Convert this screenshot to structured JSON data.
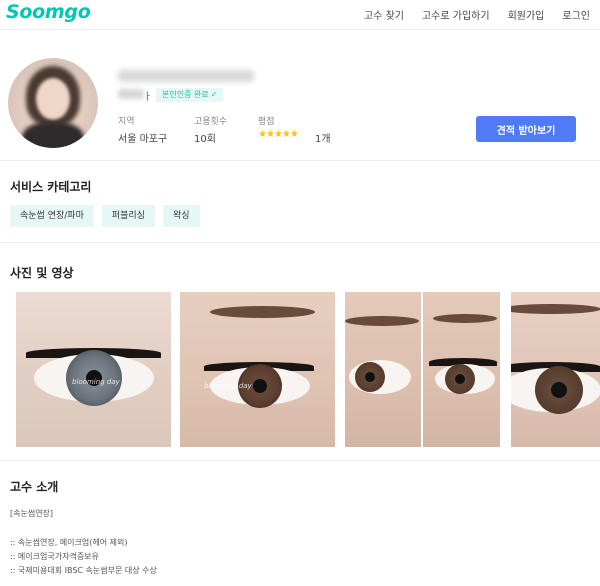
{
  "header": {
    "logo": "Soomgo",
    "nav": [
      "고수 찾기",
      "고수로 가입하기",
      "회원가입",
      "로그인"
    ]
  },
  "profile": {
    "sub_char": "ㅏ",
    "verified_badge": "본인인증 완료",
    "verified_icon": "check-icon",
    "stats": {
      "region_label": "지역",
      "region_value": "서울 마포구",
      "hires_label": "고용횟수",
      "hires_value": "10회",
      "rating_label": "평점",
      "rating_stars": 5,
      "review_count": "1개"
    },
    "quote_button": "견적 받아보기"
  },
  "services": {
    "title": "서비스 카테고리",
    "chips": [
      "속눈썹 연장/파마",
      "퍼블리싱",
      "왁싱"
    ]
  },
  "media": {
    "title": "사진 및 영상",
    "watermark": "blooming day"
  },
  "intro": {
    "title": "고수 소개",
    "lines": [
      "[속눈썹연장]",
      ":: 속눈썹연장, 메이크업(헤어 제외)",
      ":: 메이크업국가자격증보유",
      ":: 국제미용대회 IBSC 속눈썹부문 대상 수상"
    ]
  },
  "colors": {
    "brand": "#00c7ae",
    "accent_button": "#4f7bf7",
    "chip_bg": "#e6f8f5",
    "star": "#ffc107"
  }
}
